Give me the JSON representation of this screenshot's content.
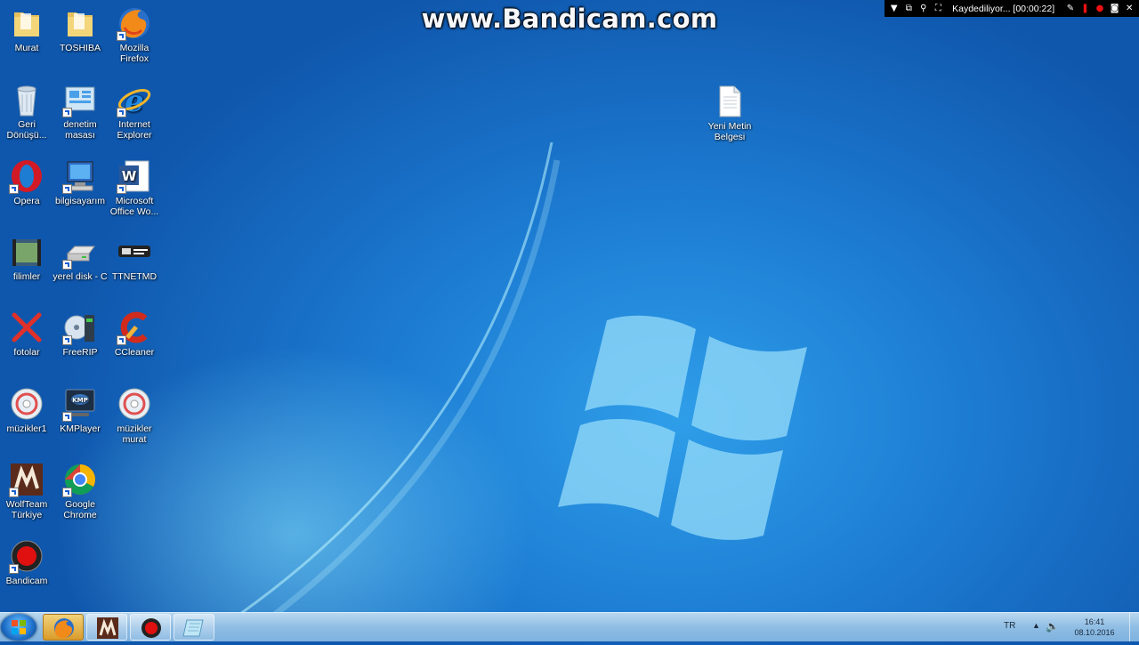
{
  "watermark": "www.Bandicam.com",
  "bandicam_toolbar": {
    "recording_label": "Kaydediliyor... [00:00:22]"
  },
  "desktop_icons": [
    {
      "label": "Murat",
      "icon": "folder-icon"
    },
    {
      "label": "TOSHIBA",
      "icon": "folder-icon"
    },
    {
      "label": "Mozilla\nFirefox",
      "icon": "firefox-icon"
    },
    {
      "label": "Geri\nDönüşü...",
      "icon": "recycle-bin-icon"
    },
    {
      "label": "denetim\nmasası",
      "icon": "control-panel-icon"
    },
    {
      "label": "Internet\nExplorer",
      "icon": "internet-explorer-icon"
    },
    {
      "label": "Opera",
      "icon": "opera-icon"
    },
    {
      "label": "bilgisayarım",
      "icon": "computer-icon"
    },
    {
      "label": "Microsoft\nOffice Wo...",
      "icon": "word-icon"
    },
    {
      "label": "filimler",
      "icon": "film-folder-icon"
    },
    {
      "label": "yerel disk - C",
      "icon": "drive-icon"
    },
    {
      "label": "TTNETMD",
      "icon": "ttnet-icon"
    },
    {
      "label": "fotolar",
      "icon": "photos-icon"
    },
    {
      "label": "FreeRIP",
      "icon": "freerip-icon"
    },
    {
      "label": "CCleaner",
      "icon": "ccleaner-icon"
    },
    {
      "label": "müzikler1",
      "icon": "music-disc-icon"
    },
    {
      "label": "KMPlayer",
      "icon": "kmplayer-icon"
    },
    {
      "label": "müzikler\nmurat",
      "icon": "music-disc-icon"
    },
    {
      "label": "WolfTeam\nTürkiye",
      "icon": "wolfteam-icon"
    },
    {
      "label": "Google\nChrome",
      "icon": "chrome-icon"
    },
    {
      "label": "Bandicam",
      "icon": "bandicam-icon"
    },
    {
      "label": "Yeni Metin\nBelgesi",
      "icon": "text-document-icon"
    }
  ],
  "taskbar": {
    "pinned": [
      "firefox-icon",
      "wolfteam-icon",
      "bandicam-icon",
      "notepad-icon"
    ],
    "language": "TR",
    "time": "16:41",
    "date": "08.10.2016"
  },
  "colors": {
    "desktop_blue": "#1d7dd3",
    "taskbar": "#8fbde4",
    "active_button": "#d99b2a"
  }
}
